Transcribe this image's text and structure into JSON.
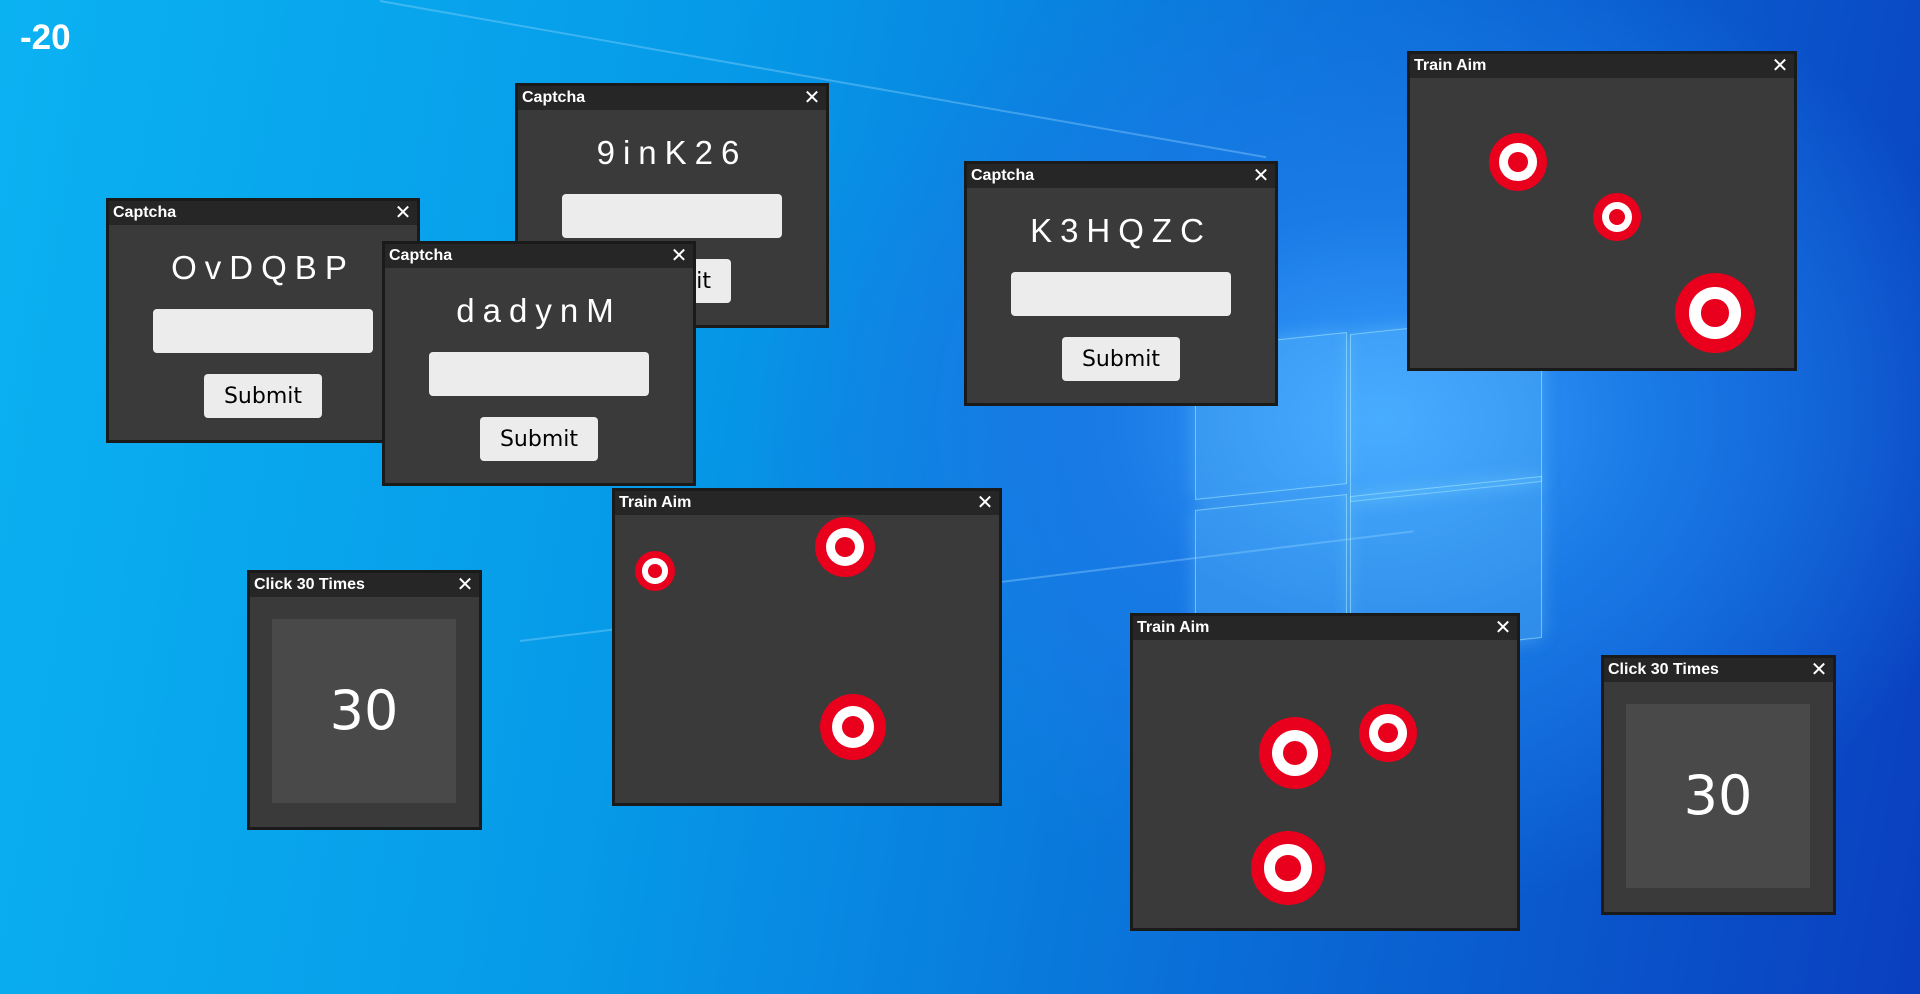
{
  "score": "-20",
  "windows": {
    "captcha1": {
      "title": "Captcha",
      "close": "✕",
      "code": "OvDQBP",
      "input_value": "",
      "submit": "Submit"
    },
    "captcha2": {
      "title": "Captcha",
      "close": "✕",
      "code": "9inK26",
      "input_value": "",
      "submit": "Submit"
    },
    "captcha3": {
      "title": "Captcha",
      "close": "✕",
      "code": "dadynM",
      "input_value": "",
      "submit": "Submit"
    },
    "captcha4": {
      "title": "Captcha",
      "close": "✕",
      "code": "K3HQZC",
      "input_value": "",
      "submit": "Submit"
    },
    "aim1": {
      "title": "Train Aim",
      "close": "✕"
    },
    "aim2": {
      "title": "Train Aim",
      "close": "✕"
    },
    "aim3": {
      "title": "Train Aim",
      "close": "✕"
    },
    "click1": {
      "title": "Click 30 Times",
      "close": "✕",
      "count": "30"
    },
    "click2": {
      "title": "Click 30 Times",
      "close": "✕",
      "count": "30"
    }
  },
  "colors": {
    "target_red": "#e8001c",
    "target_white": "#ffffff",
    "window_bg": "#3a3a3a",
    "titlebar_bg": "#262626"
  },
  "icons": {
    "close": "close-icon",
    "target": "target-icon"
  }
}
